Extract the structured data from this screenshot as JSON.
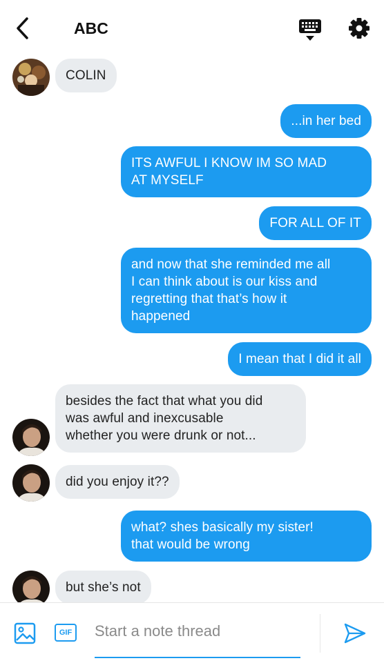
{
  "header": {
    "title": "ABC"
  },
  "messages": [
    {
      "side": "in",
      "avatar": "avatar-1",
      "text": "COLIN"
    },
    {
      "side": "out",
      "text": "...in her bed"
    },
    {
      "side": "out",
      "lines": [
        "ITS AWFUL I KNOW IM SO MAD",
        "AT MYSELF"
      ]
    },
    {
      "side": "out",
      "text": "FOR ALL OF IT"
    },
    {
      "side": "out",
      "lines": [
        "and now that she reminded me all",
        "I can think about is our kiss and",
        "regretting that that’s how it",
        "happened"
      ]
    },
    {
      "side": "out",
      "text": "I mean that I did it all"
    },
    {
      "side": "in",
      "avatar": "avatar-2",
      "lines": [
        "besides the fact that what you did",
        "was awful and inexcusable",
        "whether you were drunk or not..."
      ]
    },
    {
      "side": "in",
      "avatar": "avatar-2",
      "text": "did you enjoy it??"
    },
    {
      "side": "out",
      "lines": [
        "what? shes basically my sister!",
        "that would be wrong"
      ]
    },
    {
      "side": "in",
      "avatar": "avatar-2",
      "text": "but she’s not"
    }
  ],
  "composer": {
    "gif_label": "GIF",
    "placeholder": "Start a note thread"
  },
  "colors": {
    "outgoing": "#1c9bf0",
    "incoming": "#e9ecef",
    "accent": "#1c9bf0"
  },
  "icons": [
    "back-arrow-icon",
    "keyboard-icon",
    "gear-icon",
    "image-icon",
    "gif-icon",
    "send-icon"
  ]
}
